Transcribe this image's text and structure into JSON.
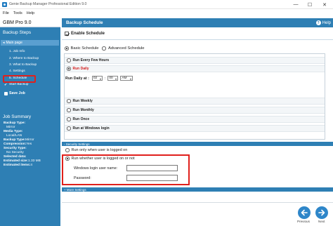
{
  "window": {
    "title": "Genie Backup Manager Professional Edition 9.0",
    "minimize": "—",
    "maximize": "☐",
    "close": "✕"
  },
  "menu": [
    "File",
    "Tools",
    "Help"
  ],
  "sidebar": {
    "product": "GBM Pro 9.0",
    "steps_heading": "Backup Steps",
    "main_page": "Main page",
    "steps": [
      "1. Job Info",
      "2. Where to Backup",
      "3. What to Backup",
      "4. Settings",
      "5. Schedule"
    ],
    "start_backup": "Start Backup",
    "save_job": "Save Job",
    "summary_heading": "Job Summary",
    "summary": {
      "backup_type_label": "Backup Type:",
      "backup_type_value": "Mirror",
      "media_type_label": "Media Type:",
      "media_type_value": "Local/LAN",
      "backup_type2_label": "Backup Type:",
      "backup_type2_value": "Mirror",
      "compression_label": "Compression:",
      "compression_value": "Yes",
      "security_label": "Security Type:",
      "security_value": "No Security",
      "selected_data_label": "Selected data:",
      "selected_data_value": "1.33 MB",
      "estimated_size_label": "Estimated size:",
      "estimated_size_value": "1.33 MB",
      "estimated_items_label": "Estimated items:",
      "estimated_items_value": "4"
    }
  },
  "main": {
    "header": "Backup Schedule",
    "help": "Help",
    "enable_schedule": "Enable Schedule",
    "basic_schedule": "Basic Schedule",
    "advanced_schedule": "Advanced Schedule",
    "options": {
      "every_few_hours": "Run Every Few Hours",
      "daily": "Run Daily",
      "weekly": "Run Weekly",
      "monthly": "Run Monthly",
      "once": "Run Once",
      "windows_login": "Run at Windows login"
    },
    "run_daily_at": "Run Daily at :",
    "hour": "02",
    "minute": "00",
    "ampm": "AM",
    "security_settings": "- Security Settings",
    "only_logged_on": "Run only when user is logged on",
    "whether_logged_on": "Run whether user is logged on or not",
    "windows_login_name": "Windows login user name:",
    "password": "Password:",
    "more_settings": "+ More Settings",
    "previous": "Previous",
    "next": "Next"
  },
  "colors": {
    "accent": "#2e7fb4",
    "highlight": "#e0201c",
    "selected_option": "#d21c1c"
  }
}
